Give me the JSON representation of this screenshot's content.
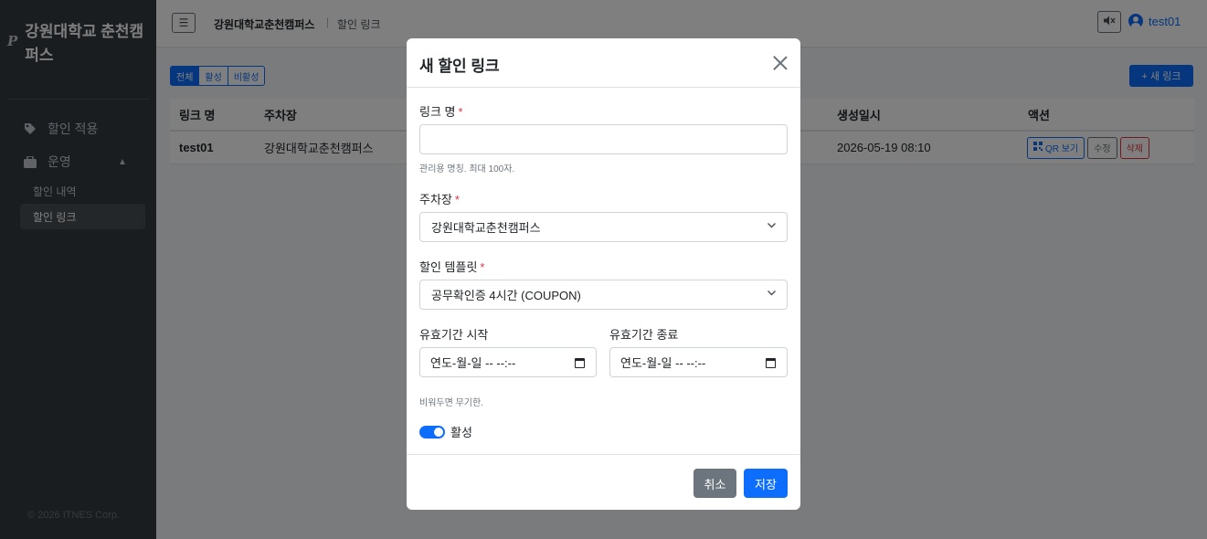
{
  "sidebar": {
    "logo": "P",
    "brand": "강원대학교 춘천캠퍼스",
    "items": [
      {
        "label": "할인 적용",
        "icon": "tag-icon"
      },
      {
        "label": "운영",
        "icon": "briefcase-icon"
      }
    ],
    "sub_items": [
      "할인 내역",
      "할인 링크"
    ],
    "copyright": "© 2026 ITNES Corp."
  },
  "header": {
    "breadcrumb_main": "강원대학교춘천캠퍼스",
    "breadcrumb_sep": "|",
    "breadcrumb_current": "할인 링크",
    "user": "test01"
  },
  "filters": [
    "전체",
    "활성",
    "비활성"
  ],
  "new_link_label": "+ 새 링크",
  "table": {
    "columns": [
      "링크 명",
      "주차장",
      "생성일시",
      "액션"
    ],
    "rows": [
      {
        "name": "test01",
        "parking": "강원대학교춘천캠퍼스",
        "created": "2026-05-19 08:10"
      }
    ],
    "actions": {
      "qr": "QR 보기",
      "edit": "수정",
      "delete": "삭제"
    }
  },
  "modal": {
    "title": "새 할인 링크",
    "link_name_label": "링크 명",
    "link_name_value": "",
    "link_name_help": "관리용 명칭. 최대 100자.",
    "parking_label": "주차장",
    "parking_value": "강원대학교춘천캠퍼스",
    "template_label": "할인 템플릿",
    "template_value": "공무확인증 4시간 (COUPON)",
    "start_label": "유효기간 시작",
    "end_label": "유효기간 종료",
    "start_value": "연도-월-일 -- --:--",
    "end_value": "연도-월-일 -- --:--",
    "period_help": "비워두면 무기한.",
    "active_label": "활성",
    "active": true,
    "cancel_label": "취소",
    "save_label": "저장"
  },
  "colors": {
    "primary": "#0d6efd",
    "danger": "#dc3545",
    "secondary": "#6c757d",
    "sidebar": "#343a40"
  }
}
